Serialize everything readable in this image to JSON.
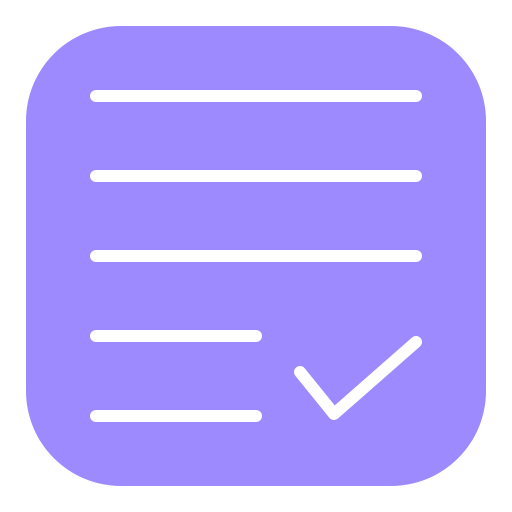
{
  "icon": {
    "name": "checklist-app-icon",
    "colors": {
      "tile": "#9d8aff",
      "stroke": "#ffffff",
      "background": "#ffffff"
    },
    "lines": [
      {
        "name": "list-line-1"
      },
      {
        "name": "list-line-2"
      },
      {
        "name": "list-line-3"
      },
      {
        "name": "list-line-4"
      },
      {
        "name": "list-line-5"
      }
    ],
    "check_mark_icon": "check-icon"
  }
}
